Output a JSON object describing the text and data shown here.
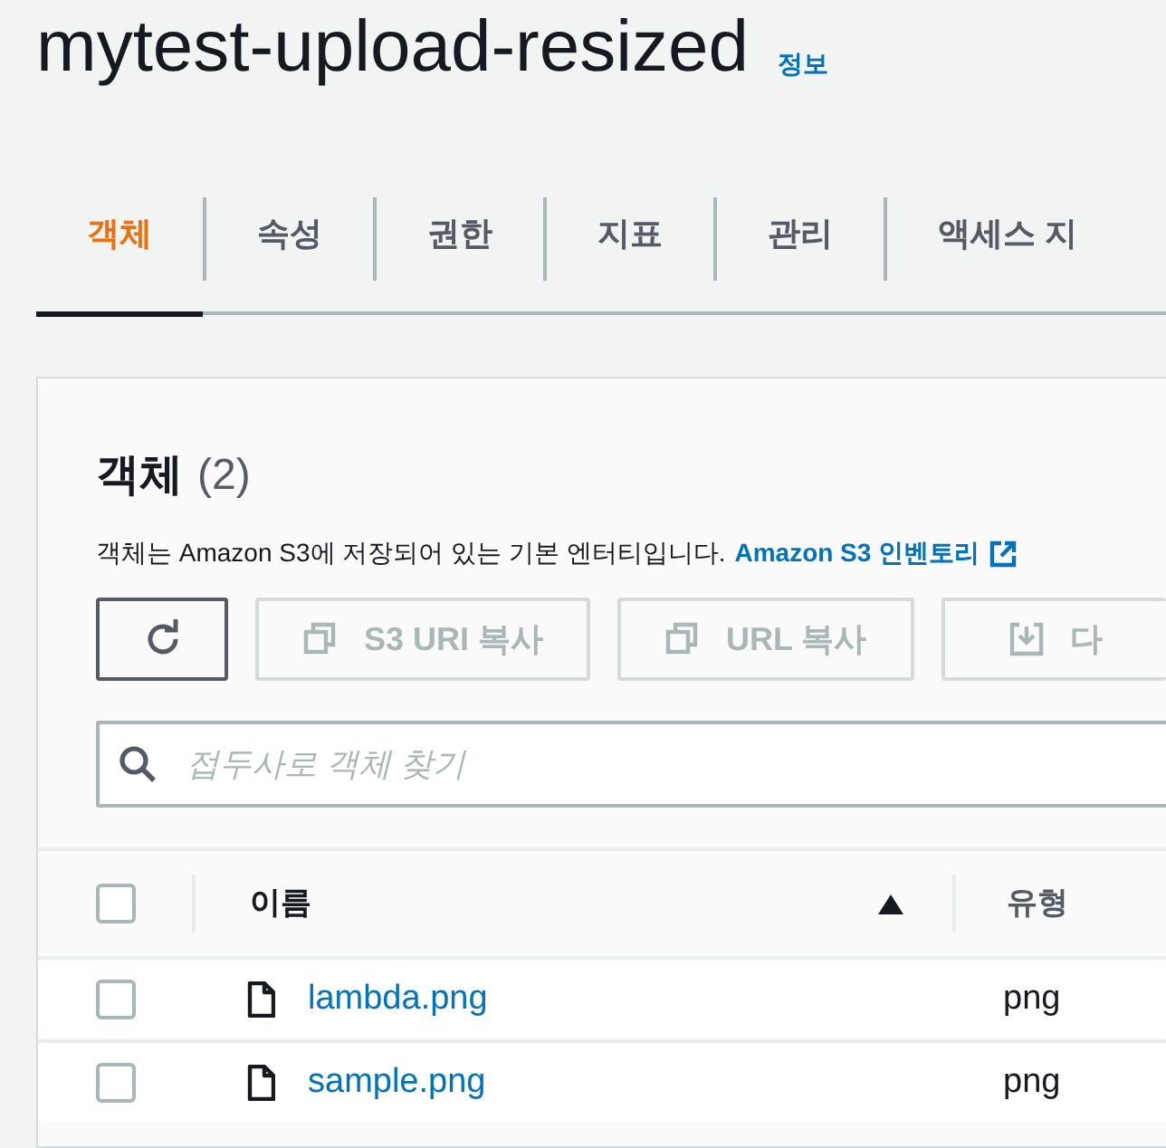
{
  "header": {
    "title": "mytest-upload-resized",
    "info_link": "정보"
  },
  "tabs": [
    {
      "label": "객체",
      "selected": true
    },
    {
      "label": "속성",
      "selected": false
    },
    {
      "label": "권한",
      "selected": false
    },
    {
      "label": "지표",
      "selected": false
    },
    {
      "label": "관리",
      "selected": false
    },
    {
      "label": "액세스 지",
      "selected": false
    }
  ],
  "panel": {
    "title": "객체",
    "count": "(2)",
    "description": "객체는 Amazon S3에 저장되어 있는 기본 엔터티입니다.",
    "link": "Amazon S3 인벤토리",
    "buttons": [
      {
        "kind": "refresh",
        "disabled": false
      },
      {
        "kind": "copy",
        "label": "S3 URI 복사",
        "disabled": true
      },
      {
        "kind": "copy",
        "label": "URL 복사",
        "disabled": true
      },
      {
        "kind": "download",
        "label": "다",
        "disabled": true
      }
    ],
    "search": {
      "placeholder": "접두사로 객체 찾기"
    },
    "table": {
      "columns": [
        "이름",
        "유형"
      ],
      "select_all_checked": false,
      "rows": [
        {
          "name": "lambda.png",
          "type": "png",
          "checked": false
        },
        {
          "name": "sample.png",
          "type": "png",
          "checked": false
        }
      ]
    }
  }
}
